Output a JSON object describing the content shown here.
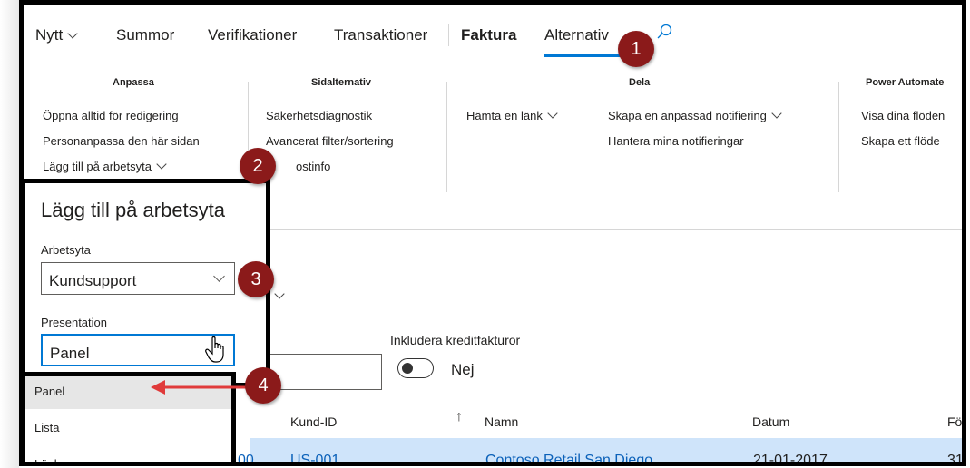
{
  "tabs": [
    {
      "label": "Nytt",
      "chevron": true
    },
    {
      "label": "Summor"
    },
    {
      "label": "Verifikationer"
    },
    {
      "label": "Transaktioner"
    },
    {
      "label": "Faktura"
    },
    {
      "label": "Alternativ"
    }
  ],
  "ribbon": {
    "groups": [
      {
        "name": "Anpassa",
        "items": [
          "Öppna alltid för redigering",
          "Personanpassa den här sidan",
          "Lägg till på arbetsyta"
        ]
      },
      {
        "name": "Sidalternativ",
        "items": [
          "Säkerhetsdiagnostik",
          "Avancerat filter/sortering",
          "ostinfo"
        ]
      },
      {
        "name": "Dela",
        "items": [
          "Hämta en länk",
          "Skapa en anpassad notifiering",
          "Hantera mina notifieringar"
        ]
      },
      {
        "name": "Power Automate",
        "items": [
          "Visa dina flöden",
          "Skapa ett flöde"
        ]
      }
    ]
  },
  "callouts": [
    "1",
    "2",
    "3",
    "4"
  ],
  "workspace_panel": {
    "title": "Lägg till på arbetsyta",
    "workspace_label": "Arbetsyta",
    "workspace_value": "Kundsupport",
    "presentation_label": "Presentation",
    "presentation_value": "Panel"
  },
  "presentation_options": [
    "Panel",
    "Lista",
    "Länka"
  ],
  "filters": {
    "credit_label": "Inkludera kreditfakturor",
    "credit_value": "Nej"
  },
  "grid": {
    "columns": [
      "Kund-ID",
      "Namn",
      "Datum",
      "Fö"
    ],
    "row": {
      "prefix": "00",
      "kund_id": "US-001",
      "namn": "Contoso Retail San Diego",
      "datum": "21-01-2017",
      "extra": "31"
    }
  },
  "colors": {
    "accent": "#0078d4",
    "callout": "#8b1a1a",
    "arrow": "#e03a3a",
    "selected_row": "#cfe4fa"
  }
}
